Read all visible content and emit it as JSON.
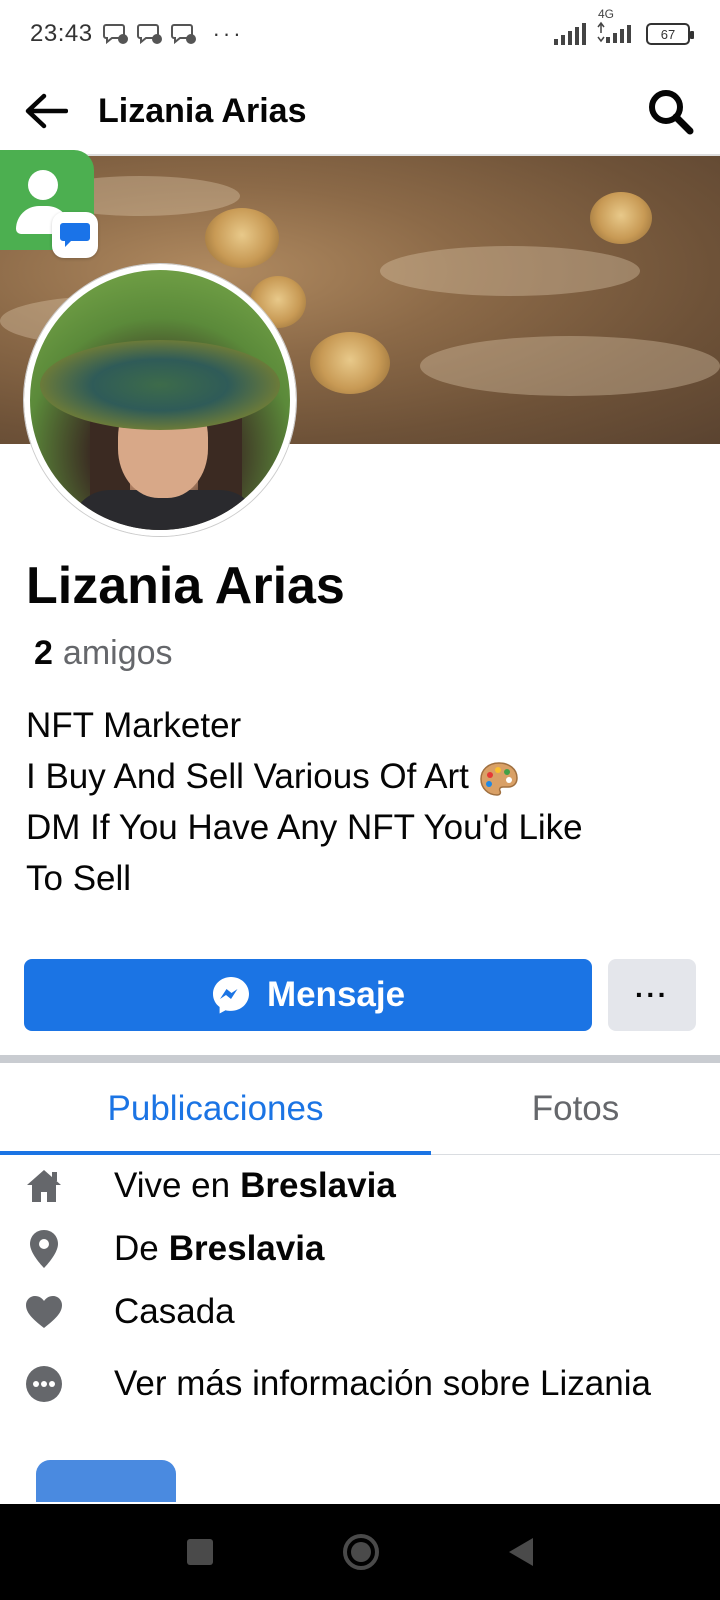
{
  "status_bar": {
    "time": "23:43",
    "more_dots": "···",
    "network": "4G",
    "battery": "67"
  },
  "header": {
    "title": "Lizania Arias"
  },
  "profile": {
    "name": "Lizania Arias",
    "friends_count": "2",
    "friends_label": "amigos",
    "bio_lines": [
      "NFT Marketer",
      "I Buy And Sell Various Of Art",
      "DM If You Have Any NFT You'd Like",
      "To Sell"
    ]
  },
  "actions": {
    "message_label": "Mensaje",
    "more_label": "···"
  },
  "tabs": [
    {
      "label": "Publicaciones",
      "active": true
    },
    {
      "label": "Fotos",
      "active": false
    }
  ],
  "details": {
    "lives_prefix": "Vive en",
    "lives_city": "Breslavia",
    "from_prefix": "De",
    "from_city": "Breslavia",
    "relationship": "Casada",
    "more_info": "Ver más información sobre Lizania"
  },
  "colors": {
    "accent": "#1b74e4",
    "secondary_text": "#65676b",
    "button_gray": "#e4e6eb"
  },
  "icons": [
    "back-arrow-icon",
    "search-icon",
    "messenger-icon",
    "home-icon",
    "location-pin-icon",
    "heart-icon",
    "more-circle-icon",
    "palette-emoji-icon"
  ]
}
